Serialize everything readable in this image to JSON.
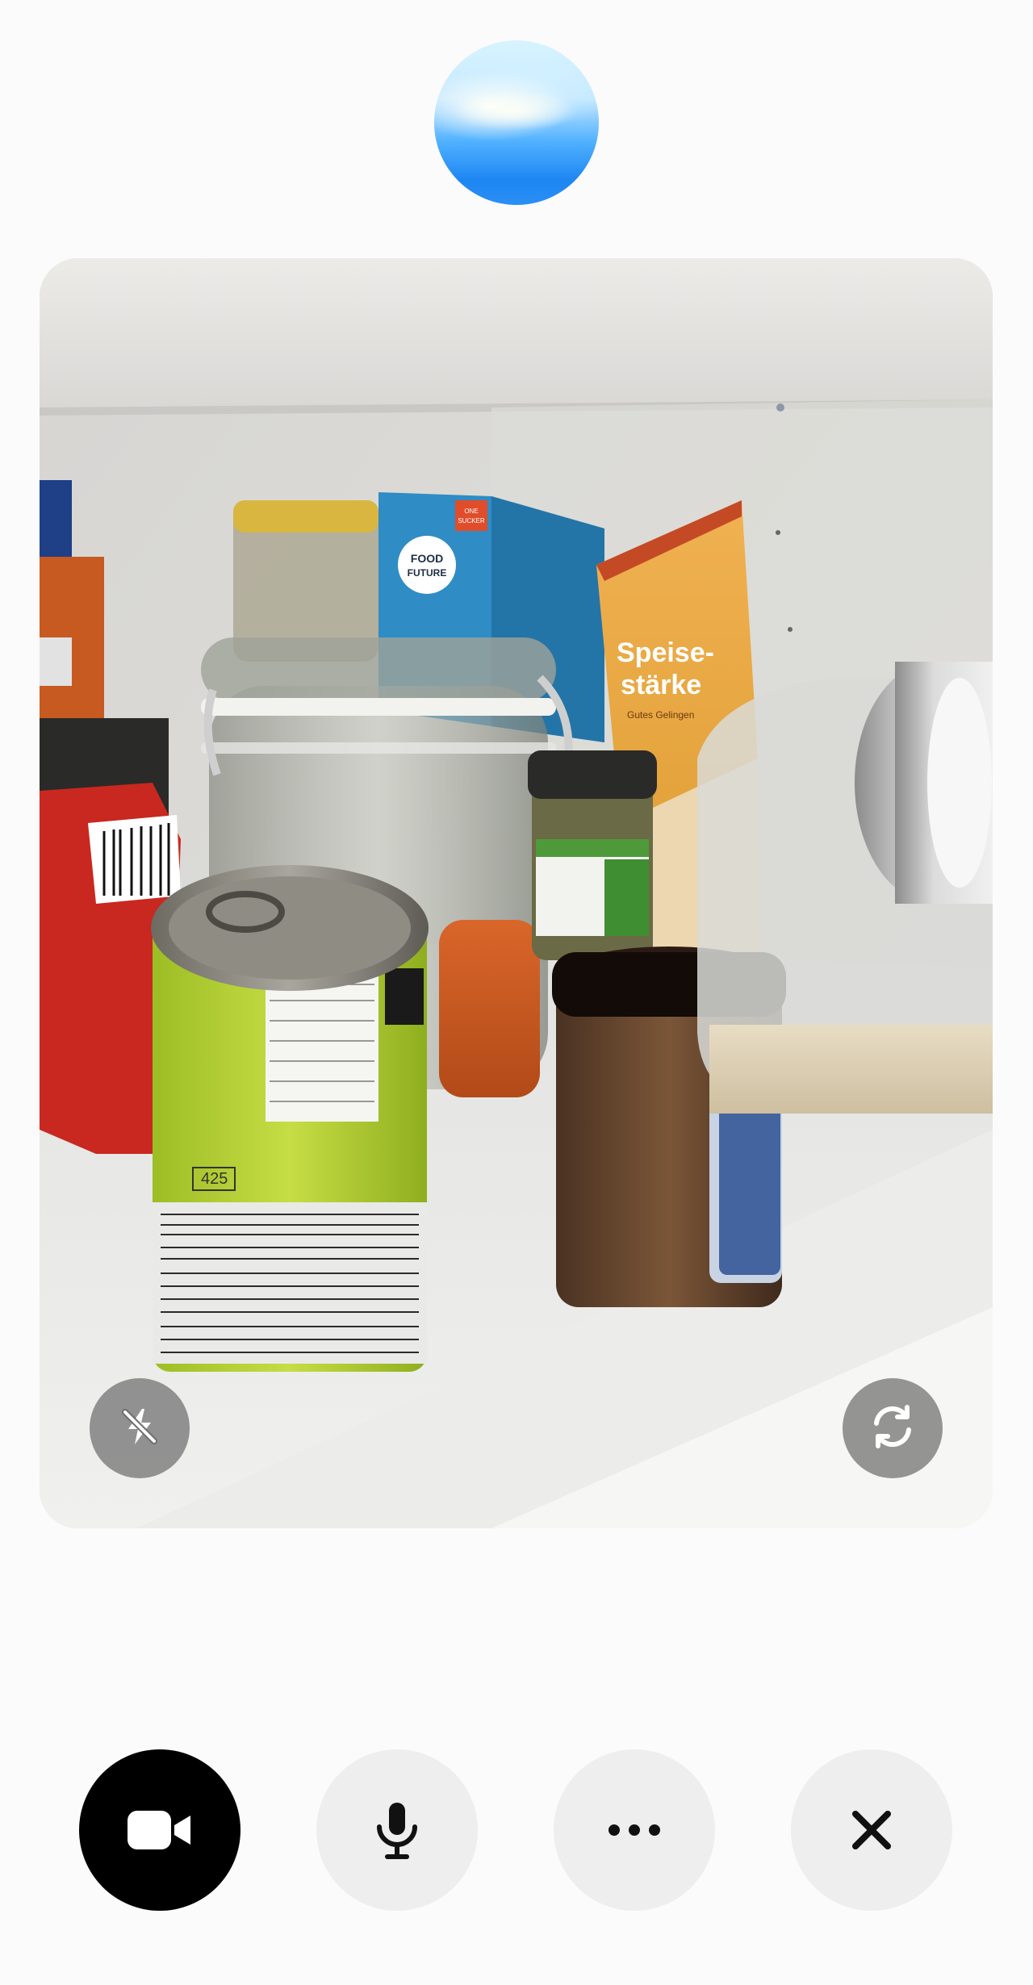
{
  "assistant_orb": {
    "icon": "assistant-orb"
  },
  "camera_preview": {
    "description_icon": "live-camera-feed",
    "flash_button": {
      "icon": "flash-off-icon",
      "state": "off"
    },
    "flip_button": {
      "icon": "flip-camera-icon"
    },
    "product_labels": {
      "carton_brand": "FOOD FUTURE",
      "carton_badge": "ONE SUCKER",
      "starch_box_title": "Speise-\nstarke",
      "starch_box_sub": "Gutes Gelingen",
      "can_number": "425"
    }
  },
  "controls": {
    "video": {
      "icon": "video-camera-icon",
      "state": "on",
      "background": "#000000"
    },
    "mic": {
      "icon": "microphone-icon"
    },
    "more": {
      "icon": "more-horizontal-icon"
    },
    "close": {
      "icon": "close-icon"
    }
  },
  "colors": {
    "page_background": "#fbfbfb",
    "control_background": "#eeeeee",
    "active_control": "#000000",
    "overlay_button": "#6e6e6e",
    "orb_blue": "#1e86f2"
  }
}
